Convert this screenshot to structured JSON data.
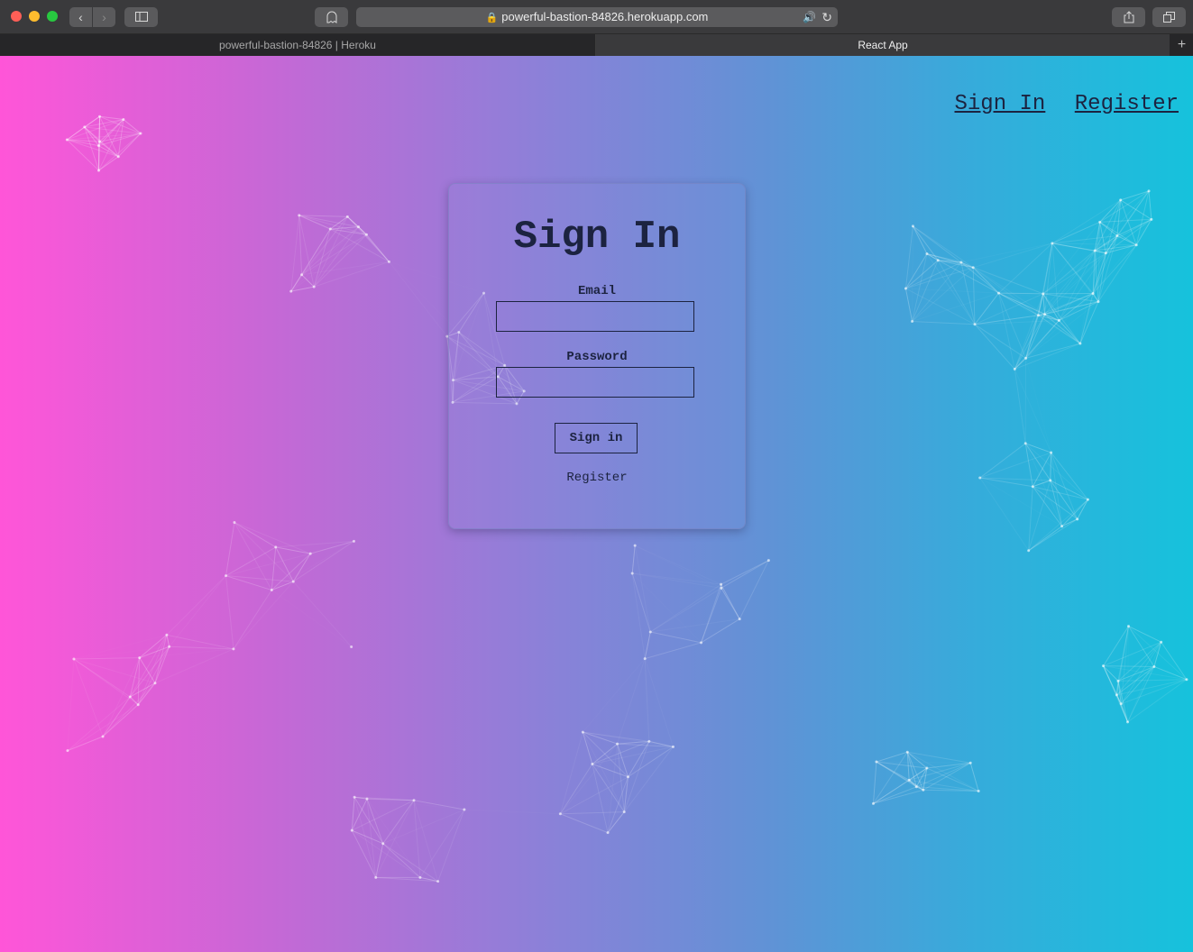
{
  "browser": {
    "address": "powerful-bastion-84826.herokuapp.com",
    "tabs": [
      {
        "title": "powerful-bastion-84826 | Heroku"
      },
      {
        "title": "React App"
      }
    ]
  },
  "nav": {
    "sign_in": "Sign In",
    "register": "Register"
  },
  "form": {
    "title": "Sign In",
    "email_label": "Email",
    "email_value": "",
    "password_label": "Password",
    "password_value": "",
    "submit_label": "Sign in",
    "register_link": "Register"
  },
  "colors": {
    "gradient_left": "#ff55d8",
    "gradient_right": "#16c2dc",
    "text": "#1c2340"
  }
}
